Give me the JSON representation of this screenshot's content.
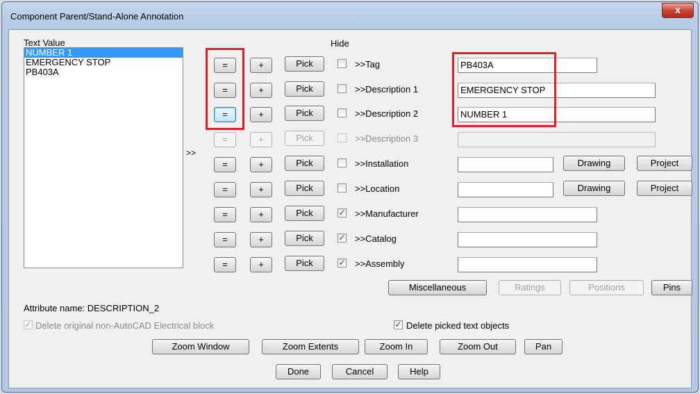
{
  "window": {
    "title": "Component Parent/Stand-Alone Annotation",
    "close_glyph": "x"
  },
  "list": {
    "header": "Text Value",
    "items": [
      "NUMBER 1",
      "EMERGENCY STOP",
      "PB403A"
    ],
    "selected_index": 0
  },
  "hide_header": "Hide",
  "arrow_label": ">>",
  "button_labels": {
    "equal": "=",
    "plus": "+",
    "pick": "Pick",
    "drawing": "Drawing",
    "project": "Project"
  },
  "rows": [
    {
      "label": ">>Tag",
      "value": "PB403A",
      "hide": false,
      "enabled": true
    },
    {
      "label": ">>Description 1",
      "value": "EMERGENCY STOP",
      "hide": false,
      "enabled": true
    },
    {
      "label": ">>Description 2",
      "value": "NUMBER 1",
      "hide": false,
      "enabled": true
    },
    {
      "label": ">>Description 3",
      "value": "",
      "hide": false,
      "enabled": false
    },
    {
      "label": ">>Installation",
      "value": "",
      "hide": false,
      "enabled": true
    },
    {
      "label": ">>Location",
      "value": "",
      "hide": false,
      "enabled": true
    },
    {
      "label": ">>Manufacturer",
      "value": "",
      "hide": true,
      "enabled": true
    },
    {
      "label": ">>Catalog",
      "value": "",
      "hide": true,
      "enabled": true
    },
    {
      "label": ">>Assembly",
      "value": "",
      "hide": true,
      "enabled": true
    }
  ],
  "lower_buttons": {
    "misc": "Miscellaneous",
    "ratings": "Ratings",
    "positions": "Positions",
    "pins": "Pins"
  },
  "attribute_name": "Attribute name: DESCRIPTION_2",
  "delete_original": {
    "label": "Delete original non-AutoCAD Electrical block",
    "checked": true,
    "enabled": false
  },
  "delete_picked": {
    "label": "Delete picked text objects",
    "checked": true
  },
  "zoom": {
    "window": "Zoom Window",
    "extents": "Zoom Extents",
    "in": "Zoom In",
    "out": "Zoom Out",
    "pan": "Pan"
  },
  "footer": {
    "done": "Done",
    "cancel": "Cancel",
    "help": "Help"
  },
  "colors": {
    "selection": "#3399ff",
    "highlight": "#e0202a"
  }
}
